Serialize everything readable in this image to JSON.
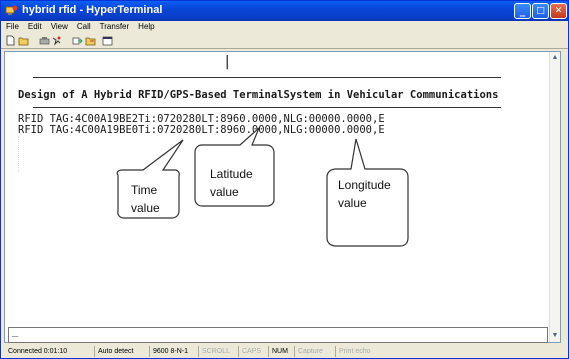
{
  "window": {
    "title": "hybrid rfid - HyperTerminal",
    "minimize": "_",
    "maximize": "□",
    "close": "✕"
  },
  "menu": [
    "File",
    "Edit",
    "View",
    "Call",
    "Transfer",
    "Help"
  ],
  "toolbar_icons": [
    "new-icon",
    "open-icon",
    "call-icon",
    "hangup-icon",
    "disconnect-icon",
    "send-icon",
    "receive-icon",
    "properties-icon"
  ],
  "terminal": {
    "cursor_line": "|",
    "heading": "Design of A Hybrid RFID/GPS-Based TerminalSystem in Vehicular Communications",
    "lines": [
      "RFID TAG:4C00A19BE2Ti:0720280LT:8960.0000,NLG:00000.0000,E",
      "RFID TAG:4C00A19BE0Ti:0720280LT:8960.0000,NLG:00000.0000,E"
    ],
    "bottom_cursor": "_"
  },
  "annotations": {
    "time_line1": "Time",
    "time_line2": "value",
    "lat_line1": "Latitude",
    "lat_line2": "value",
    "lon_line1": "Longitude",
    "lon_line2": "value"
  },
  "status": {
    "connected": "Connected 0:01:10",
    "detect": "Auto detect",
    "settings": "9600 8-N-1",
    "scroll": "SCROLL",
    "caps": "CAPS",
    "num": "NUM",
    "capture": "Capture",
    "print": "Print echo"
  },
  "colors": {
    "titlebar": "#0a49d8",
    "text": "#1a1a1a"
  }
}
